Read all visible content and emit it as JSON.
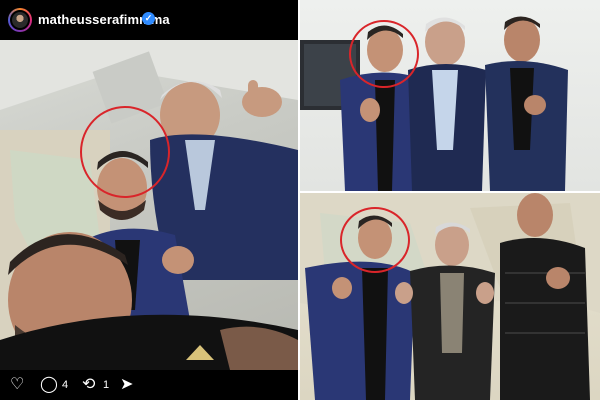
{
  "post": {
    "username": "matheusserafimmma",
    "verified_icon": "verified-badge-icon",
    "likes_icon": "heart-icon",
    "comment_icon": "comment-icon",
    "comment_count": "4",
    "repost_icon": "repost-icon",
    "repost_count": "1",
    "share_icon": "share-icon"
  },
  "colors": {
    "highlight_circle": "#d9252a",
    "verified": "#2f8bff",
    "panel_bg": "#000000"
  }
}
